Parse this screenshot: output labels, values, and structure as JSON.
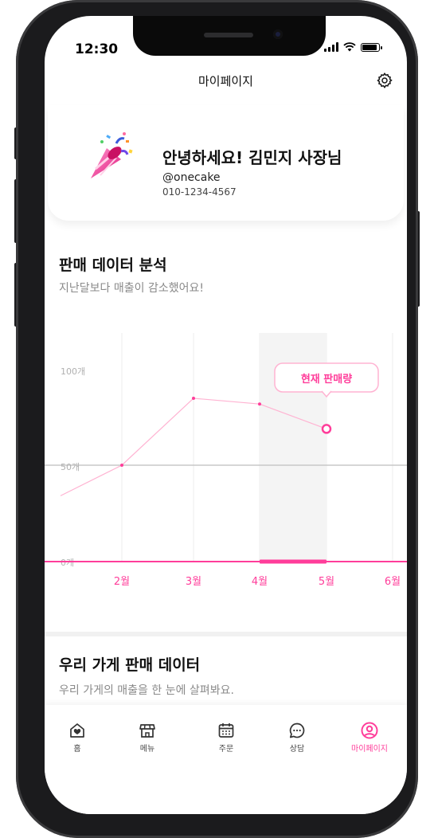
{
  "status_bar": {
    "time": "12:30"
  },
  "header": {
    "title": "마이페이지"
  },
  "profile": {
    "greeting": "안녕하세요! 김민지 사장님",
    "handle": "@onecake",
    "phone": "010-1234-4567"
  },
  "sales_analysis": {
    "title": "판매 데이터 분석",
    "subtitle": "지난달보다 매출이 감소했어요!"
  },
  "chart_data": {
    "type": "line",
    "x": [
      "2월",
      "3월",
      "4월",
      "5월",
      "6월"
    ],
    "series": [
      {
        "values": [
          50,
          85,
          82,
          69
        ]
      }
    ],
    "y_tick_labels": [
      "100개",
      "50개",
      "0개"
    ],
    "ylim": [
      0,
      100
    ],
    "reference_line": 50,
    "callout": "현재 판매량",
    "highlighted_category": "5월",
    "accent_color": "#ff3d9a"
  },
  "store_sales": {
    "title": "우리 가게 판매 데이터",
    "subtitle": "우리 가게의 매출을 한 눈에 살펴봐요."
  },
  "tabbar": {
    "items": [
      {
        "label": "홈",
        "icon": "home-icon"
      },
      {
        "label": "메뉴",
        "icon": "store-icon"
      },
      {
        "label": "주문",
        "icon": "calendar-icon"
      },
      {
        "label": "상담",
        "icon": "chat-icon"
      },
      {
        "label": "마이페이지",
        "icon": "user-icon"
      }
    ],
    "active_index": 4
  }
}
